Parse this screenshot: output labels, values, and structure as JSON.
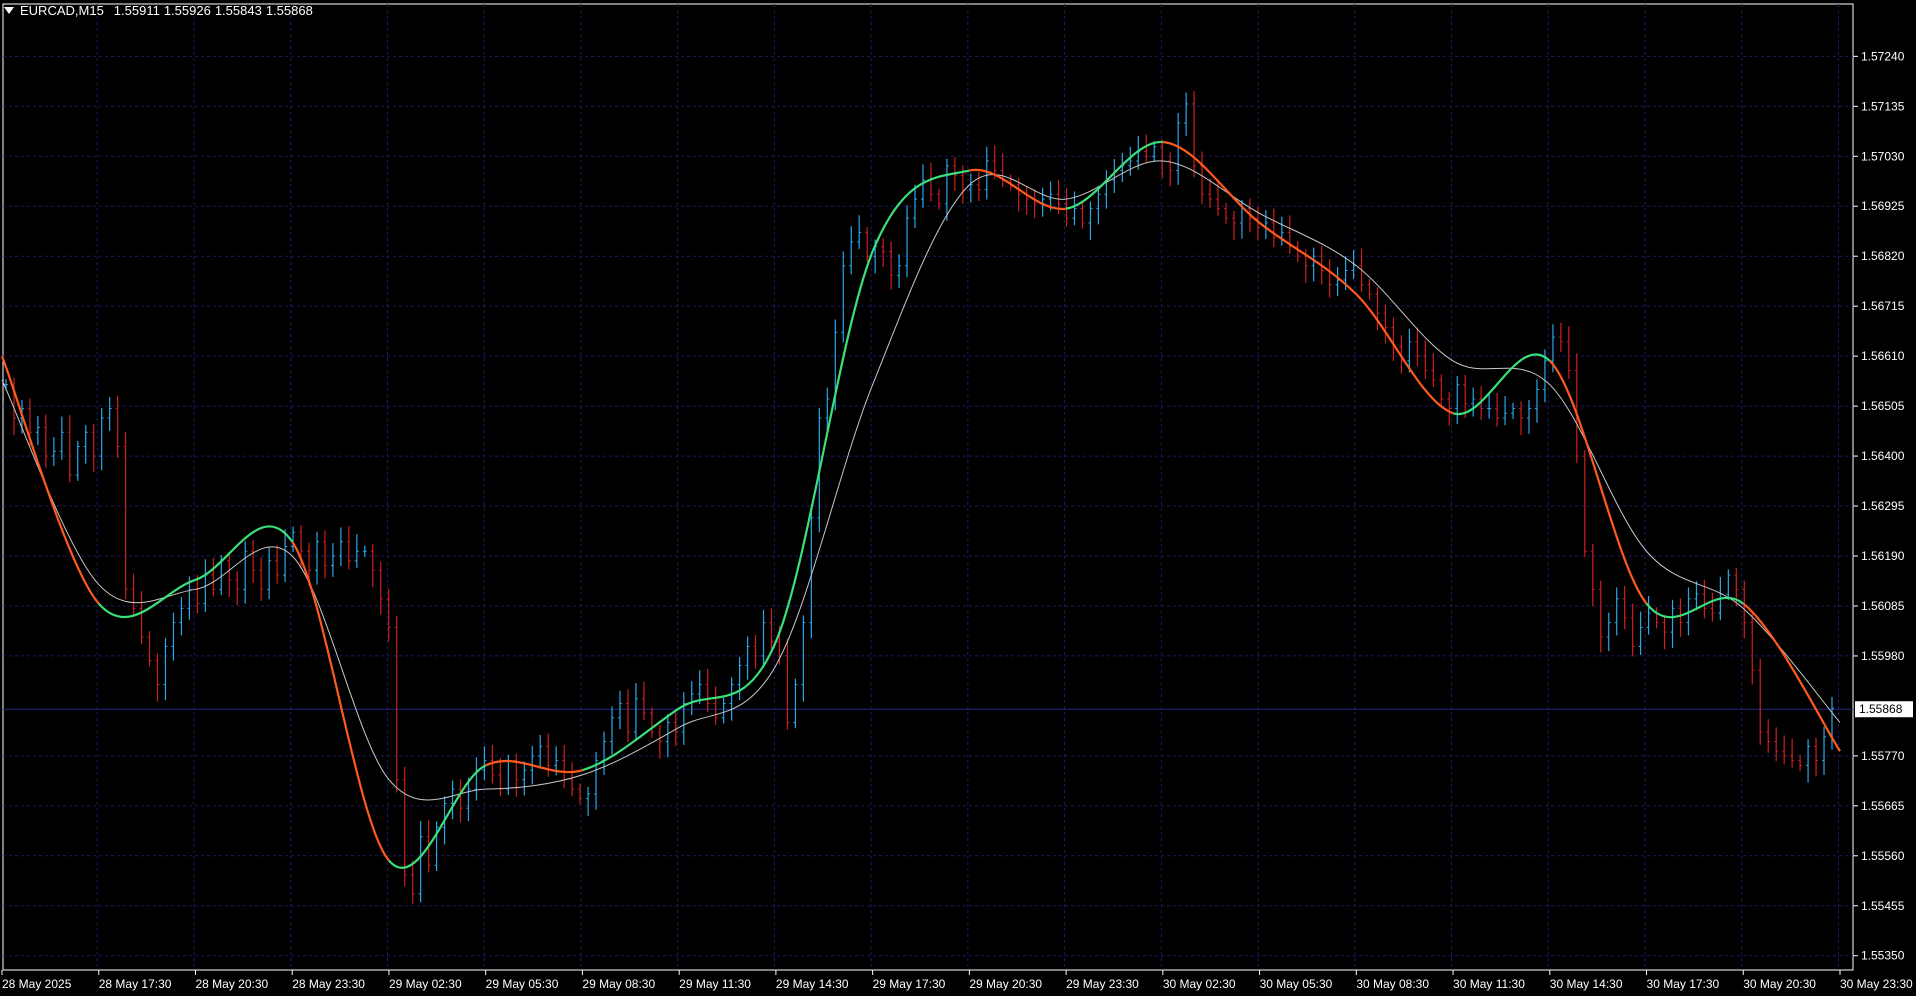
{
  "header": {
    "symbol": "EURCAD,M15",
    "open": "1.55911",
    "high": "1.55926",
    "low": "1.55843",
    "close": "1.55868"
  },
  "colors": {
    "background": "#000000",
    "grid": "#1b1b66",
    "up_bar": "#2aa8e6",
    "down_bar": "#cc1f1f",
    "ma_up": "#3be07a",
    "ma_down": "#ff5a1e",
    "slow_ma": "#c8c8c8",
    "axis_text": "#ffffff",
    "price_line": "#1f2b8a"
  },
  "chart_data": {
    "type": "line",
    "title": "EURCAD,M15",
    "current_price": "1.55868",
    "y_ticks": [
      "1.57240",
      "1.57135",
      "1.57030",
      "1.56925",
      "1.56820",
      "1.56715",
      "1.56610",
      "1.56505",
      "1.56400",
      "1.56295",
      "1.56190",
      "1.56085",
      "1.55980",
      "1.55770",
      "1.55665",
      "1.55560",
      "1.55455",
      "1.55350"
    ],
    "ylim": [
      1.5532,
      1.5735
    ],
    "x_ticks": [
      "28 May 2025",
      "28 May 17:30",
      "28 May 20:30",
      "28 May 23:30",
      "29 May 02:30",
      "29 May 05:30",
      "29 May 08:30",
      "29 May 11:30",
      "29 May 14:30",
      "29 May 17:30",
      "29 May 20:30",
      "29 May 23:30",
      "30 May 02:30",
      "30 May 05:30",
      "30 May 08:30",
      "30 May 11:30",
      "30 May 14:30",
      "30 May 17:30",
      "30 May 20:30",
      "30 May 23:30"
    ],
    "x": [
      "28 May 2025",
      "28 May 17:30",
      "28 May 20:30",
      "28 May 23:30",
      "29 May 02:30",
      "29 May 05:30",
      "29 May 08:30",
      "29 May 11:30",
      "29 May 14:30",
      "29 May 17:30",
      "29 May 20:30",
      "29 May 23:30",
      "30 May 02:30",
      "30 May 05:30",
      "30 May 08:30",
      "30 May 11:30",
      "30 May 14:30",
      "30 May 17:30",
      "30 May 20:30",
      "30 May 23:30"
    ],
    "series": [
      {
        "values": [
          1.5661,
          1.5609,
          1.5614,
          1.5622,
          1.5555,
          1.5575,
          1.5574,
          1.5587,
          1.5601,
          1.5683,
          1.57,
          1.5692,
          1.5706,
          1.5689,
          1.5674,
          1.5649,
          1.566,
          1.5609,
          1.5609,
          1.5578
        ]
      },
      {
        "values": [
          1.5656,
          1.5613,
          1.5612,
          1.5619,
          1.5572,
          1.557,
          1.5573,
          1.5583,
          1.5596,
          1.5655,
          1.5697,
          1.5694,
          1.5702,
          1.5691,
          1.568,
          1.566,
          1.5655,
          1.562,
          1.5608,
          1.5584
        ]
      }
    ],
    "bars": {
      "x_start": "28 May 2025",
      "step_minutes": 15,
      "close": [
        1.5655,
        1.5648,
        1.565,
        1.5645,
        1.5646,
        1.564,
        1.5641,
        1.5645,
        1.5636,
        1.5642,
        1.5645,
        1.564,
        1.5648,
        1.565,
        1.5642,
        1.5612,
        1.5608,
        1.5602,
        1.5597,
        1.5592,
        1.56,
        1.5605,
        1.5608,
        1.5612,
        1.5609,
        1.5615,
        1.5612,
        1.5618,
        1.5614,
        1.5612,
        1.562,
        1.5616,
        1.5612,
        1.5618,
        1.5615,
        1.5621,
        1.5624,
        1.562,
        1.5616,
        1.5622,
        1.5617,
        1.5619,
        1.5622,
        1.5618,
        1.562,
        1.562,
        1.5616,
        1.561,
        1.5604,
        1.5572,
        1.5552,
        1.5548,
        1.556,
        1.5554,
        1.5562,
        1.5567,
        1.557,
        1.5566,
        1.557,
        1.5574,
        1.5576,
        1.5573,
        1.557,
        1.5576,
        1.5572,
        1.5574,
        1.5577,
        1.5579,
        1.5575,
        1.5576,
        1.5572,
        1.557,
        1.5568,
        1.5569,
        1.5576,
        1.558,
        1.5585,
        1.5588,
        1.5582,
        1.5589,
        1.5586,
        1.5582,
        1.558,
        1.5584,
        1.5582,
        1.5588,
        1.559,
        1.5592,
        1.5588,
        1.5585,
        1.5588,
        1.5592,
        1.5596,
        1.56,
        1.5598,
        1.5605,
        1.5601,
        1.5598,
        1.5584,
        1.5592,
        1.5605,
        1.5627,
        1.5648,
        1.5652,
        1.5666,
        1.568,
        1.5685,
        1.5687,
        1.5682,
        1.5684,
        1.5683,
        1.5678,
        1.568,
        1.569,
        1.5694,
        1.5698,
        1.5695,
        1.5693,
        1.5701,
        1.5699,
        1.5696,
        1.5697,
        1.5696,
        1.5702,
        1.57,
        1.5698,
        1.5697,
        1.5695,
        1.5694,
        1.5693,
        1.5694,
        1.5695,
        1.5693,
        1.569,
        1.5692,
        1.5689,
        1.5692,
        1.5695,
        1.5698,
        1.57,
        1.5701,
        1.5702,
        1.5704,
        1.5703,
        1.5705,
        1.5702,
        1.57,
        1.571,
        1.5714,
        1.5701,
        1.5695,
        1.5694,
        1.5692,
        1.569,
        1.5689,
        1.5692,
        1.569,
        1.5688,
        1.5689,
        1.5686,
        1.5687,
        1.5684,
        1.5682,
        1.568,
        1.5682,
        1.5679,
        1.5676,
        1.5677,
        1.5679,
        1.568,
        1.5676,
        1.5674,
        1.567,
        1.5667,
        1.5663,
        1.566,
        1.5664,
        1.5661,
        1.5658,
        1.5656,
        1.5652,
        1.565,
        1.5655,
        1.5651,
        1.5652,
        1.565,
        1.565,
        1.5648,
        1.5649,
        1.565,
        1.5648,
        1.565,
        1.5654,
        1.566,
        1.5665,
        1.5664,
        1.5658,
        1.564,
        1.562,
        1.5612,
        1.5602,
        1.5605,
        1.561,
        1.5606,
        1.56,
        1.5604,
        1.5607,
        1.5605,
        1.5603,
        1.5608,
        1.5605,
        1.561,
        1.5611,
        1.5608,
        1.5607,
        1.5611,
        1.5615,
        1.5612,
        1.5605,
        1.5595,
        1.5582,
        1.558,
        1.5578,
        1.5577,
        1.5576,
        1.5575,
        1.5579,
        1.5576,
        1.5581,
        1.5587
      ]
    }
  }
}
